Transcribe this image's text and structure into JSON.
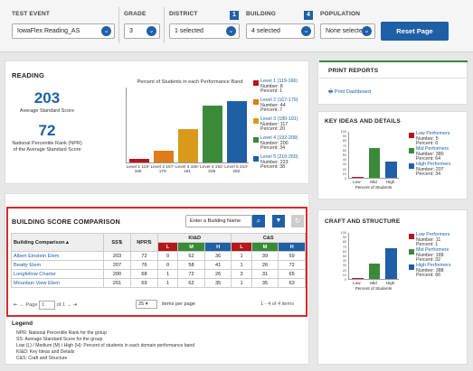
{
  "filters": {
    "test_event": {
      "label": "TEST EVENT",
      "value": "IowaFlex Reading_AS"
    },
    "grade": {
      "label": "GRADE",
      "value": "3"
    },
    "district": {
      "label": "DISTRICT",
      "value": "1 selected",
      "badge": "1"
    },
    "building": {
      "label": "BUILDING",
      "value": "4 selected",
      "badge": "4"
    },
    "population": {
      "label": "POPULATION",
      "value": "None selected"
    },
    "reset_label": "Reset Page"
  },
  "reading": {
    "title": "READING",
    "avg_score": "203",
    "avg_score_label": "Average Standard Score",
    "npr": "72",
    "npr_label": "National Percentile Rank (NPR) of the Average Standard Score",
    "chart_data": {
      "type": "bar",
      "title": "Percent of Students in each Performance Band",
      "categories": [
        "Level 1 119-166",
        "Level 2 167-179",
        "Level 3 180-191",
        "Level 4 192-209",
        "Level 5 210-260"
      ],
      "values": [
        2,
        7,
        20,
        34,
        37
      ],
      "ylim": [
        0,
        100
      ],
      "colors": [
        "#b5161b",
        "#e07b1a",
        "#d99a1b",
        "#3a8a3a",
        "#1f5fa6"
      ],
      "legend": [
        {
          "name": "Level 1 (119-166)",
          "number": "Number: 8",
          "percent": "Percent: 1"
        },
        {
          "name": "Level 2 (167-179)",
          "number": "Number: 44",
          "percent": "Percent: 7"
        },
        {
          "name": "Level 3 (180-191)",
          "number": "Number: 117",
          "percent": "Percent: 20"
        },
        {
          "name": "Level 4 (192-209)",
          "number": "Number: 200",
          "percent": "Percent: 34"
        },
        {
          "name": "Level 5 (210-260)",
          "number": "Number: 223",
          "percent": "Percent: 38"
        }
      ]
    }
  },
  "print_reports": {
    "title": "PRINT REPORTS",
    "item": "Print Dashboard"
  },
  "key_ideas": {
    "title": "KEY IDEAS AND DETAILS",
    "chart_data": {
      "type": "bar",
      "categories": [
        "Low",
        "Mid",
        "High"
      ],
      "values": [
        1,
        64,
        34
      ],
      "ylim": [
        0,
        100
      ],
      "yticks": [
        "100",
        "90",
        "80",
        "70",
        "60",
        "50",
        "40",
        "30",
        "20",
        "10",
        "0"
      ],
      "xlabel": "Percent of Students",
      "legend": [
        {
          "name": "Low Performers",
          "number": "Number: 5",
          "percent": "Percent: 0"
        },
        {
          "name": "Mid Performers",
          "number": "Number: 380",
          "percent": "Percent: 64"
        },
        {
          "name": "High Performers",
          "number": "Number: 207",
          "percent": "Percent: 34"
        }
      ]
    }
  },
  "craft": {
    "title": "CRAFT AND STRUCTURE",
    "chart_data": {
      "type": "bar",
      "categories": [
        "Low",
        "Mid",
        "High"
      ],
      "values": [
        1,
        32,
        66
      ],
      "ylim": [
        0,
        100
      ],
      "yticks": [
        "100",
        "90",
        "80",
        "70",
        "60",
        "50",
        "40",
        "30",
        "20",
        "10",
        "0"
      ],
      "xlabel": "Percent of Students",
      "legend": [
        {
          "name": "Low Performers",
          "number": "Number: 11",
          "percent": "Percent: 1"
        },
        {
          "name": "Mid Performers",
          "number": "Number: 189",
          "percent": "Percent: 32"
        },
        {
          "name": "High Performers",
          "number": "Number: 388",
          "percent": "Percent: 66"
        }
      ]
    }
  },
  "comparison": {
    "title": "BUILDING SCORE COMPARISON",
    "search_placeholder": "Enter a Building Name",
    "headers": {
      "building": "Building Comparison",
      "ss": "SS",
      "npr": "NPR",
      "kid": "KI&D",
      "cs": "C&S",
      "l": "L",
      "m": "M",
      "h": "H"
    },
    "rows": [
      {
        "name": "Albert Einstein Elem",
        "ss": "203",
        "npr": "72",
        "kl": "0",
        "km": "62",
        "kh": "36",
        "cl": "1",
        "cm": "39",
        "ch": "59"
      },
      {
        "name": "Beatty Elem",
        "ss": "207",
        "npr": "76",
        "kl": "0",
        "km": "58",
        "kh": "41",
        "cl": "1",
        "cm": "26",
        "ch": "72"
      },
      {
        "name": "Longfellow Charter",
        "ss": "200",
        "npr": "68",
        "kl": "1",
        "km": "72",
        "kh": "26",
        "cl": "3",
        "cm": "31",
        "ch": "65"
      },
      {
        "name": "Mountain View Elem",
        "ss": "201",
        "npr": "69",
        "kl": "1",
        "km": "62",
        "kh": "35",
        "cl": "1",
        "cm": "35",
        "ch": "63"
      }
    ],
    "pager": {
      "page_label": "Page",
      "page": "1",
      "of": "of 1",
      "per_page": "25",
      "per_page_label": "items per page",
      "range": "1 - 4 of 4 items"
    }
  },
  "legend": {
    "title": "Legend",
    "lines": [
      "NPR: National Percentile Rank for the group",
      "SS: Average Standard Score for the group",
      "Low (L) / Medium (M) / High (H): Percent of students in each domain performance band",
      "KI&D: Key Ideas and Details",
      "C&S: Craft and Structure"
    ]
  },
  "colors": {
    "accent": "#1f5fa6",
    "low": "#b5161b",
    "mid": "#3a8a3a",
    "high": "#1f5fa6",
    "highlight": "#d62828"
  }
}
